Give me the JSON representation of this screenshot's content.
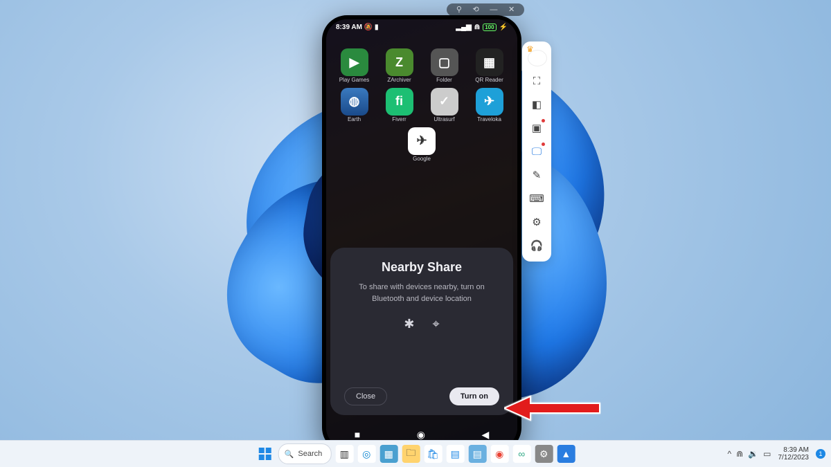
{
  "window_controls": {
    "pin": "⚲",
    "refresh": "⟲",
    "min": "—",
    "close": "✕"
  },
  "phone": {
    "status": {
      "time": "8:39 AM",
      "dnd": "🔕",
      "battery_left": "▮",
      "signal": "▂▄▆",
      "wifi": "⋒",
      "battery": "100",
      "charge": "⚡"
    },
    "apps": [
      {
        "label": "Play Games",
        "icon": "▶",
        "cls": "ic-play"
      },
      {
        "label": "ZArchiver",
        "icon": "Z",
        "cls": "ic-za"
      },
      {
        "label": "Folder",
        "icon": "▢",
        "cls": "ic-folder"
      },
      {
        "label": "QR Reader",
        "icon": "▦",
        "cls": "ic-qr"
      },
      {
        "label": "Earth",
        "icon": "◍",
        "cls": "ic-earth"
      },
      {
        "label": "Fiverr",
        "icon": "fi",
        "cls": "ic-fiverr"
      },
      {
        "label": "Ultrasurf",
        "icon": "✓",
        "cls": "ic-ultra"
      },
      {
        "label": "Traveloka",
        "icon": "✈",
        "cls": "ic-trav"
      },
      {
        "label": "Google",
        "icon": "✈",
        "cls": "ic-google"
      }
    ],
    "sheet": {
      "title": "Nearby Share",
      "desc": "To share with devices nearby, turn on Bluetooth and device location",
      "bt": "✱",
      "loc": "⌖",
      "close": "Close",
      "turn_on": "Turn on"
    },
    "nav": {
      "recent": "■",
      "home": "◉",
      "back": "◀"
    }
  },
  "sidetool": [
    {
      "name": "fullscreen-icon",
      "glyph": "⛶"
    },
    {
      "name": "camera-icon",
      "glyph": "◧"
    },
    {
      "name": "record-icon",
      "glyph": "▣",
      "dot": true
    },
    {
      "name": "stream-icon",
      "glyph": "🖵",
      "active": true,
      "dot": true
    },
    {
      "name": "brush-icon",
      "glyph": "✎"
    },
    {
      "name": "keyboard-icon",
      "glyph": "⌨"
    },
    {
      "name": "settings-icon",
      "glyph": "⚙"
    },
    {
      "name": "support-icon",
      "glyph": "🎧"
    }
  ],
  "taskbar": {
    "search": "Search",
    "icons": [
      {
        "name": "taskview",
        "g": "▥",
        "bg": "#fff",
        "c": "#333"
      },
      {
        "name": "edge",
        "g": "◎",
        "bg": "#fff",
        "c": "#0a84d0"
      },
      {
        "name": "app1",
        "g": "▦",
        "bg": "#4aa0d0",
        "c": "#fff"
      },
      {
        "name": "explorer",
        "g": "🗀",
        "bg": "#ffd36e",
        "c": "#333"
      },
      {
        "name": "store",
        "g": "🛍",
        "bg": "#fff",
        "c": "#1e88e5"
      },
      {
        "name": "app2",
        "g": "▤",
        "bg": "#fff",
        "c": "#1e88e5"
      },
      {
        "name": "notes",
        "g": "▤",
        "bg": "#6ab0e0",
        "c": "#fff"
      },
      {
        "name": "chrome",
        "g": "◉",
        "bg": "#fff",
        "c": "#ea4335"
      },
      {
        "name": "app3",
        "g": "∞",
        "bg": "#fff",
        "c": "#3a8"
      },
      {
        "name": "app4",
        "g": "⚙",
        "bg": "#888",
        "c": "#fff"
      },
      {
        "name": "mumu",
        "g": "▲",
        "bg": "#2a7de0",
        "c": "#fff"
      }
    ],
    "tray": {
      "up": "^",
      "wifi": "⋒",
      "sound": "🔉",
      "batt": "▭",
      "time": "8:39 AM",
      "date": "7/12/2023",
      "notif": "1"
    }
  }
}
